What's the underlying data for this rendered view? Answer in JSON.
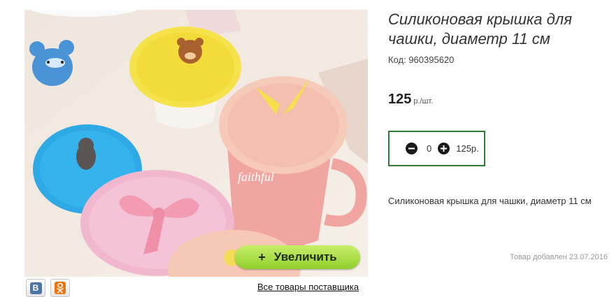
{
  "product": {
    "title": "Силиконовая крышка для чашки, диаметр 11 см",
    "code": "Код: 960395620",
    "price": "125",
    "price_unit": "р./шт.",
    "description": "Силиконовая крышка для чашки, диаметр 11 см",
    "added": "Товар добавлен 23.07.2016"
  },
  "cart": {
    "quantity": "0",
    "total": "125р."
  },
  "gallery": {
    "zoom_label": "Увеличить",
    "zoom_plus": "+",
    "supplier_link": "Все товары поставщика"
  },
  "share": {
    "vk_label": "В"
  },
  "colors": {
    "accent_green": "#2e7d32",
    "zoom_button": "#9fd83a",
    "vk": "#4c75a3",
    "ok": "#f2720c"
  }
}
